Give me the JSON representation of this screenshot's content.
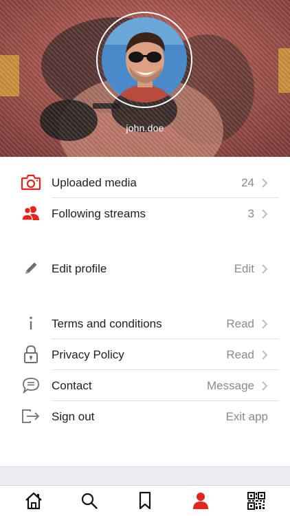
{
  "profile": {
    "username": "john.doe"
  },
  "colors": {
    "accent": "#e8231c",
    "text": "#1e1e1e",
    "muted": "#8a8a8a",
    "icon_gray": "#6f6f6f"
  },
  "menu": {
    "uploaded_media": {
      "label": "Uploaded media",
      "value": "24",
      "icon": "camera-icon"
    },
    "following_streams": {
      "label": "Following streams",
      "value": "3",
      "icon": "users-icon"
    },
    "edit_profile": {
      "label": "Edit profile",
      "value": "Edit",
      "icon": "pencil-icon"
    },
    "terms": {
      "label": "Terms and conditions",
      "value": "Read",
      "icon": "info-icon"
    },
    "privacy": {
      "label": "Privacy Policy",
      "value": "Read",
      "icon": "lock-icon"
    },
    "contact": {
      "label": "Contact",
      "value": "Message",
      "icon": "chat-bubble-icon"
    },
    "sign_out": {
      "label": "Sign out",
      "value": "Exit app",
      "icon": "sign-out-icon"
    }
  },
  "tabbar": {
    "tabs": [
      {
        "name": "home",
        "icon": "home-icon"
      },
      {
        "name": "search",
        "icon": "search-icon"
      },
      {
        "name": "bookmarks",
        "icon": "bookmark-icon"
      },
      {
        "name": "profile",
        "icon": "person-icon",
        "active": true
      },
      {
        "name": "qr-code",
        "icon": "qr-code-icon"
      }
    ]
  }
}
